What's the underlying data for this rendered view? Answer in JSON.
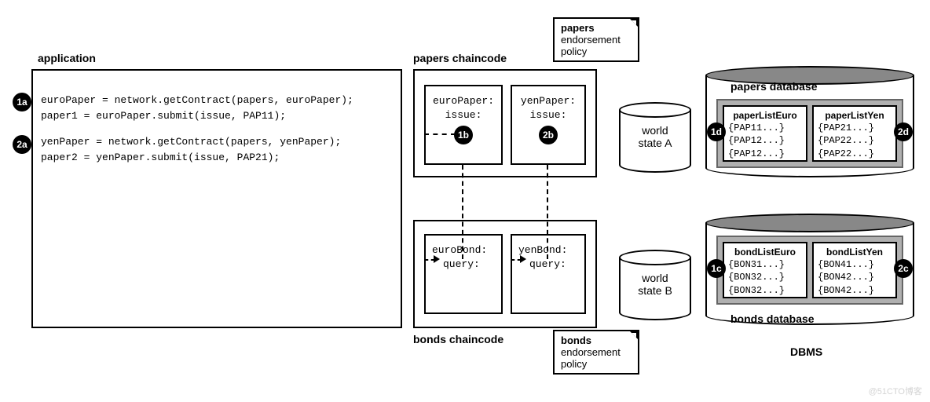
{
  "labels": {
    "application": "application",
    "papers_chaincode": "papers chaincode",
    "bonds_chaincode": "bonds chaincode",
    "papers_db": "papers database",
    "bonds_db": "bonds database",
    "dbms": "DBMS",
    "world_state_a_1": "world",
    "world_state_a_2": "state A",
    "world_state_b_1": "world",
    "world_state_b_2": "state B"
  },
  "notes": {
    "papers_policy_1": "papers",
    "papers_policy_2": "endorsement",
    "papers_policy_3": "policy",
    "bonds_policy_1": "bonds",
    "bonds_policy_2": "endorsement",
    "bonds_policy_3": "policy"
  },
  "code": {
    "l1": "euroPaper = network.getContract(papers, euroPaper);",
    "l2": "paper1 = euroPaper.submit(issue, PAP11);",
    "l3": "yenPaper = network.getContract(papers, yenPaper);",
    "l4": "paper2 = yenPaper.submit(issue, PAP21);"
  },
  "chaincode": {
    "euroPaper_1": "euroPaper:",
    "euroPaper_2": "issue:",
    "yenPaper_1": "yenPaper:",
    "yenPaper_2": "issue:",
    "euroBond_1": "euroBond:",
    "euroBond_2": "query:",
    "yenBond_1": "yenBond:",
    "yenBond_2": "query:"
  },
  "db": {
    "paperListEuro_h": "paperListEuro",
    "paperListEuro_1": "{PAP11...}",
    "paperListEuro_2": "{PAP12...}",
    "paperListEuro_3": "{PAP12...}",
    "paperListYen_h": "paperListYen",
    "paperListYen_1": "{PAP21...}",
    "paperListYen_2": "{PAP22...}",
    "paperListYen_3": "{PAP22...}",
    "bondListEuro_h": "bondListEuro",
    "bondListEuro_1": "{BON31...}",
    "bondListEuro_2": "{BON32...}",
    "bondListEuro_3": "{BON32...}",
    "bondListYen_h": "bondListYen",
    "bondListYen_1": "{BON41...}",
    "bondListYen_2": "{BON42...}",
    "bondListYen_3": "{BON42...}"
  },
  "badges": {
    "b1a": "1a",
    "b2a": "2a",
    "b1b": "1b",
    "b2b": "2b",
    "b1c": "1c",
    "b2c": "2c",
    "b1d": "1d",
    "b2d": "2d"
  },
  "watermark": "@51CTO博客"
}
